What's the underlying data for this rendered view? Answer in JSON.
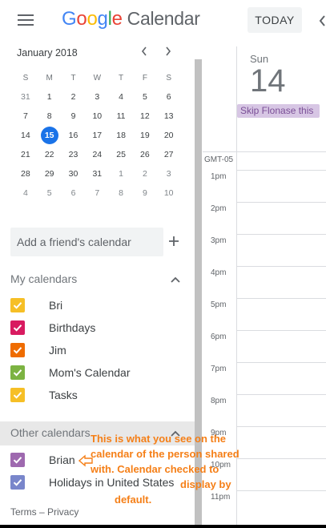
{
  "header": {
    "logo_letters": [
      "G",
      "o",
      "o",
      "g",
      "l",
      "e"
    ],
    "logo_word": "Calendar",
    "today_label": "TODAY",
    "menu_icon": "hamburger-icon",
    "prev_icon": "chevron-left-icon"
  },
  "mini_calendar": {
    "month_label": "January 2018",
    "weekdays": [
      "S",
      "M",
      "T",
      "W",
      "T",
      "F",
      "S"
    ],
    "weeks": [
      [
        {
          "d": "31",
          "m": true
        },
        {
          "d": "1"
        },
        {
          "d": "2"
        },
        {
          "d": "3"
        },
        {
          "d": "4"
        },
        {
          "d": "5"
        },
        {
          "d": "6"
        }
      ],
      [
        {
          "d": "7"
        },
        {
          "d": "8"
        },
        {
          "d": "9"
        },
        {
          "d": "10"
        },
        {
          "d": "11"
        },
        {
          "d": "12"
        },
        {
          "d": "13"
        }
      ],
      [
        {
          "d": "14"
        },
        {
          "d": "15",
          "today": true
        },
        {
          "d": "16"
        },
        {
          "d": "17"
        },
        {
          "d": "18"
        },
        {
          "d": "19"
        },
        {
          "d": "20"
        }
      ],
      [
        {
          "d": "21"
        },
        {
          "d": "22"
        },
        {
          "d": "23"
        },
        {
          "d": "24"
        },
        {
          "d": "25"
        },
        {
          "d": "26"
        },
        {
          "d": "27"
        }
      ],
      [
        {
          "d": "28"
        },
        {
          "d": "29"
        },
        {
          "d": "30"
        },
        {
          "d": "31"
        },
        {
          "d": "1",
          "m": true
        },
        {
          "d": "2",
          "m": true
        },
        {
          "d": "3",
          "m": true
        }
      ],
      [
        {
          "d": "4",
          "m": true
        },
        {
          "d": "5",
          "m": true
        },
        {
          "d": "6",
          "m": true
        },
        {
          "d": "7",
          "m": true
        },
        {
          "d": "8",
          "m": true
        },
        {
          "d": "9",
          "m": true
        },
        {
          "d": "10",
          "m": true
        }
      ]
    ]
  },
  "sidebar": {
    "friend_placeholder": "Add a friend's calendar",
    "add_icon": "plus-icon",
    "my_calendars_title": "My calendars",
    "my_calendars": [
      {
        "label": "Bri",
        "color": "#f6bf26"
      },
      {
        "label": "Birthdays",
        "color": "#d81b60"
      },
      {
        "label": "Jim",
        "color": "#ef6c00"
      },
      {
        "label": "Mom's Calendar",
        "color": "#7cb342"
      },
      {
        "label": "Tasks",
        "color": "#f6bf26"
      }
    ],
    "other_calendars_title": "Other calendars",
    "other_calendars": [
      {
        "label": "Brian",
        "color": "#9e69af"
      },
      {
        "label": "Holidays in United States",
        "color": "#7986cb"
      }
    ],
    "footer": "Terms – Privacy"
  },
  "main": {
    "day_of_week": "Sun",
    "day_number": "14",
    "event_title": "Skip Flonase this",
    "event_color": "#d7c6e4",
    "timezone": "GMT-05",
    "hours": [
      "1pm",
      "2pm",
      "3pm",
      "4pm",
      "5pm",
      "6pm",
      "7pm",
      "8pm",
      "9pm",
      "10pm",
      "11pm"
    ]
  },
  "annotation": {
    "lines": [
      "This is what you see on the",
      "calendar of the person shared",
      "with.  Calendar checked to",
      "display by",
      "default."
    ],
    "color": "#f57f17",
    "arrow_icon": "arrow-left-icon"
  }
}
